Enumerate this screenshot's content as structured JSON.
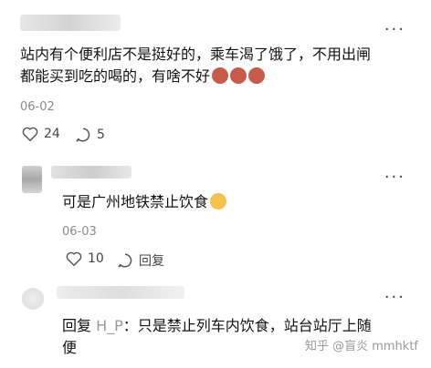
{
  "comment1": {
    "more_label": "···",
    "line1": "站内有个便利店不是挺好的，乘车渴了饿了，不用出闸",
    "line2": "都能买到吃的喝的，有啥不好",
    "date": "06-02",
    "like_count": "24",
    "reply_count": "5"
  },
  "comment2": {
    "more_label": "···",
    "text": "可是广州地铁禁止饮食",
    "date": "06-03",
    "like_count": "10",
    "reply_label": "回复"
  },
  "comment3": {
    "more_label": "···",
    "reply_prefix": "回复 ",
    "reply_to": "H_P",
    "line1_rest": "：只是禁止列车内饮食，站台站厅上随",
    "line2": "便"
  },
  "watermark": "知乎 @盲炎 mmhktf",
  "colors": {
    "emoji_red": "#c85a4a",
    "emoji_yellow": "#f2c14e"
  }
}
